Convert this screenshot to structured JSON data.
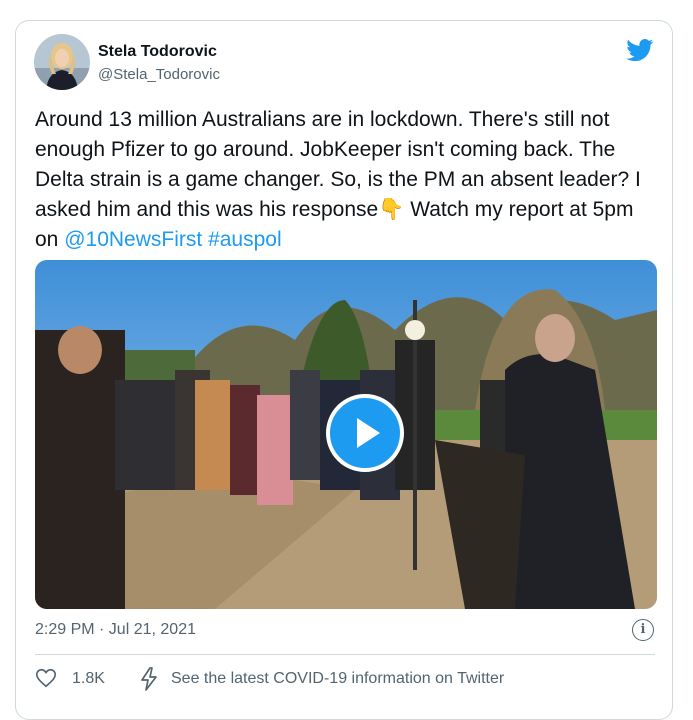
{
  "author": {
    "name": "Stela Todorovic",
    "handle": "@Stela_Todorovic"
  },
  "tweet": {
    "text": "Around 13 million Australians are in lockdown. There's still not enough Pfizer to go around. JobKeeper isn't coming back. The Delta strain is a game changer. So, is the PM an absent leader? I asked him and this was his response",
    "emoji": "👇",
    "text_after": "Watch my report at 5pm on",
    "mention": "@10NewsFirst",
    "hashtag": "#auspol",
    "timestamp": "2:29 PM · Jul 21, 2021"
  },
  "actions": {
    "likes": "1.8K",
    "covid_link": "See the latest COVID-19 information on Twitter"
  },
  "colors": {
    "accent": "#1d9bf0",
    "text": "#0f1419",
    "muted": "#536471",
    "border": "#cfd9de"
  },
  "icons": [
    "twitter-bird-icon",
    "play-icon",
    "info-icon",
    "heart-icon",
    "bolt-icon"
  ]
}
